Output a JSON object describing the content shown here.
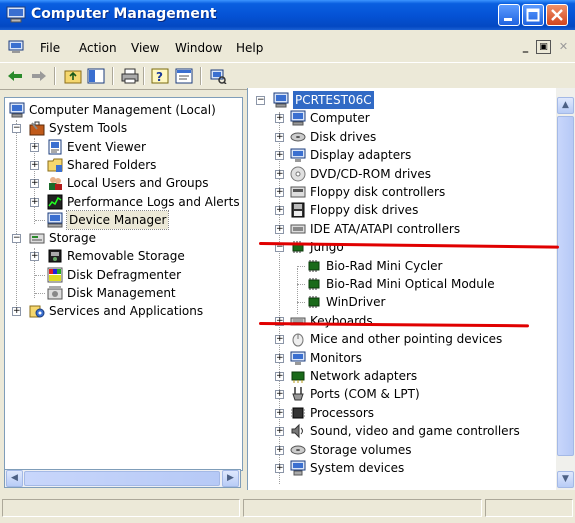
{
  "window": {
    "title": "Computer Management"
  },
  "menu": {
    "items": [
      "File",
      "Action",
      "View",
      "Window",
      "Help"
    ]
  },
  "left_tree": [
    {
      "label": "Computer Management (Local)",
      "icon": "computer-icon",
      "expanded": true
    },
    {
      "label": "System Tools",
      "icon": "toolbox-icon",
      "expanded": true
    },
    {
      "label": "Event Viewer",
      "icon": "event-viewer-icon",
      "expanded": false
    },
    {
      "label": "Shared Folders",
      "icon": "folder-icon",
      "expanded": false
    },
    {
      "label": "Local Users and Groups",
      "icon": "users-icon",
      "expanded": false
    },
    {
      "label": "Performance Logs and Alerts",
      "icon": "performance-icon",
      "expanded": false
    },
    {
      "label": "Device Manager",
      "icon": "device-manager-icon",
      "selected": true
    },
    {
      "label": "Storage",
      "icon": "storage-icon",
      "expanded": true
    },
    {
      "label": "Removable Storage",
      "icon": "removable-storage-icon",
      "expanded": false
    },
    {
      "label": "Disk Defragmenter",
      "icon": "defrag-icon"
    },
    {
      "label": "Disk Management",
      "icon": "disk-management-icon"
    },
    {
      "label": "Services and Applications",
      "icon": "services-icon",
      "expanded": false
    }
  ],
  "right_tree": [
    {
      "label": "PCRTEST06C",
      "icon": "computer-icon",
      "selected": true
    },
    {
      "label": "Computer",
      "icon": "computer-icon"
    },
    {
      "label": "Disk drives",
      "icon": "disk-drive-icon"
    },
    {
      "label": "Display adapters",
      "icon": "display-icon"
    },
    {
      "label": "DVD/CD-ROM drives",
      "icon": "cdrom-icon"
    },
    {
      "label": "Floppy disk controllers",
      "icon": "floppy-controller-icon"
    },
    {
      "label": "Floppy disk drives",
      "icon": "floppy-icon"
    },
    {
      "label": "IDE ATA/ATAPI controllers",
      "icon": "ide-icon"
    },
    {
      "label": "Jungo",
      "icon": "chip-icon",
      "expanded": true
    },
    {
      "label": "Bio-Rad Mini Cycler",
      "icon": "chip-icon"
    },
    {
      "label": "Bio-Rad Mini Optical Module",
      "icon": "chip-icon"
    },
    {
      "label": "WinDriver",
      "icon": "chip-icon"
    },
    {
      "label": "Keyboards",
      "icon": "keyboard-icon"
    },
    {
      "label": "Mice and other pointing devices",
      "icon": "mouse-icon"
    },
    {
      "label": "Monitors",
      "icon": "monitor-icon"
    },
    {
      "label": "Network adapters",
      "icon": "network-icon"
    },
    {
      "label": "Ports (COM & LPT)",
      "icon": "port-icon"
    },
    {
      "label": "Processors",
      "icon": "processor-icon"
    },
    {
      "label": "Sound, video and game controllers",
      "icon": "sound-icon"
    },
    {
      "label": "Storage volumes",
      "icon": "storage-volume-icon"
    },
    {
      "label": "System devices",
      "icon": "system-device-icon"
    }
  ],
  "colors": {
    "titlebar": "#0553d6",
    "selection": "#316ac5",
    "annotation": "#e00000"
  }
}
